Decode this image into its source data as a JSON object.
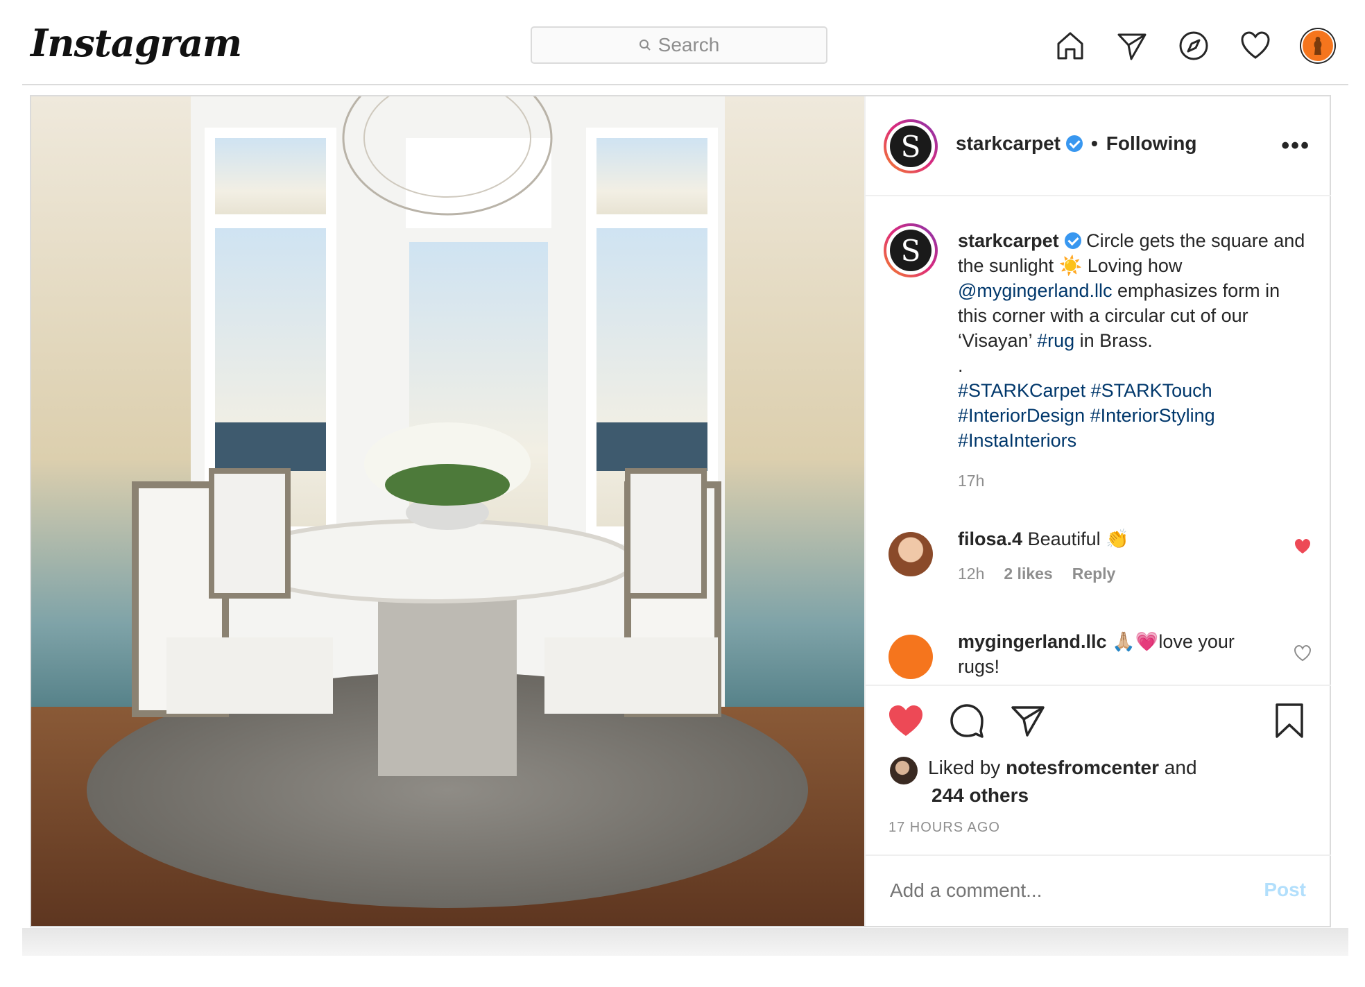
{
  "nav": {
    "logo": "Instagram",
    "search_placeholder": "Search",
    "icons": [
      "home-icon",
      "direct-icon",
      "explore-icon",
      "activity-icon",
      "profile-avatar"
    ]
  },
  "post": {
    "author": "starkcarpet",
    "follow_state": "Following",
    "caption": {
      "line1": "Circle gets the square and the sunlight",
      "sun": "☀️",
      "line2": "Loving how",
      "mention": "@mygingerland.llc",
      "line3": "emphasizes form in this corner with a circular cut of our ‘Visayan’",
      "hashtag_rug": "#rug",
      "line4": "in Brass.",
      "dot": ".",
      "hashtags": "#STARKCarpet #STARKTouch #InteriorDesign #InteriorStyling #InstaInteriors",
      "time": "17h"
    },
    "comments": [
      {
        "user": "filosa.4",
        "text": "Beautiful 👏",
        "time": "12h",
        "likes": "2 likes",
        "reply": "Reply",
        "liked": true
      },
      {
        "user": "mygingerland.llc",
        "text": "🙏🏼💗love your rugs!",
        "liked": false
      }
    ],
    "liked_by_prefix": "Liked by",
    "liked_by_user": "notesfromcenter",
    "liked_by_and": "and",
    "liked_by_others": "244 others",
    "timestamp": "17 HOURS AGO",
    "add_comment_placeholder": "Add a comment...",
    "post_button": "Post"
  },
  "colors": {
    "accent_blue": "#3897f0",
    "like_red": "#ed4956",
    "link": "#00376b"
  }
}
